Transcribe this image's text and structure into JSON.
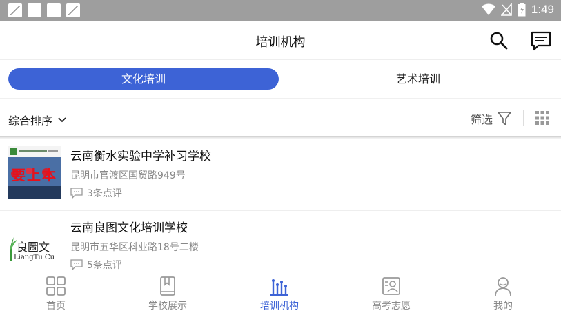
{
  "status_bar": {
    "time": "1:49"
  },
  "app_bar": {
    "title": "培训机构"
  },
  "tabs": [
    {
      "label": "文化培训",
      "active": true
    },
    {
      "label": "艺术培训",
      "active": false
    }
  ],
  "filter_bar": {
    "sort_label": "综合排序",
    "filter_label": "筛选"
  },
  "schools": [
    {
      "name": "云南衡水实验中学补习学校",
      "address": "昆明市官渡区国贸路949号",
      "reviews": "3条点评",
      "thumb_text": "要上本"
    },
    {
      "name": "云南良图文化培训学校",
      "address": "昆明市五华区科业路18号二楼",
      "reviews": "5条点评",
      "thumb_text": "良圖文",
      "thumb_subtext": "LiangTu Cu"
    }
  ],
  "bottom_nav": [
    {
      "label": "首页",
      "icon": "grid-icon",
      "active": false
    },
    {
      "label": "学校展示",
      "icon": "book-icon",
      "active": false
    },
    {
      "label": "培训机构",
      "icon": "chart-bars-icon",
      "active": true
    },
    {
      "label": "高考志愿",
      "icon": "profile-card-icon",
      "active": false
    },
    {
      "label": "我的",
      "icon": "person-icon",
      "active": false
    }
  ],
  "colors": {
    "accent": "#3d63d6",
    "status_bar": "#9e9e9e",
    "inactive": "#8a8a8a"
  }
}
